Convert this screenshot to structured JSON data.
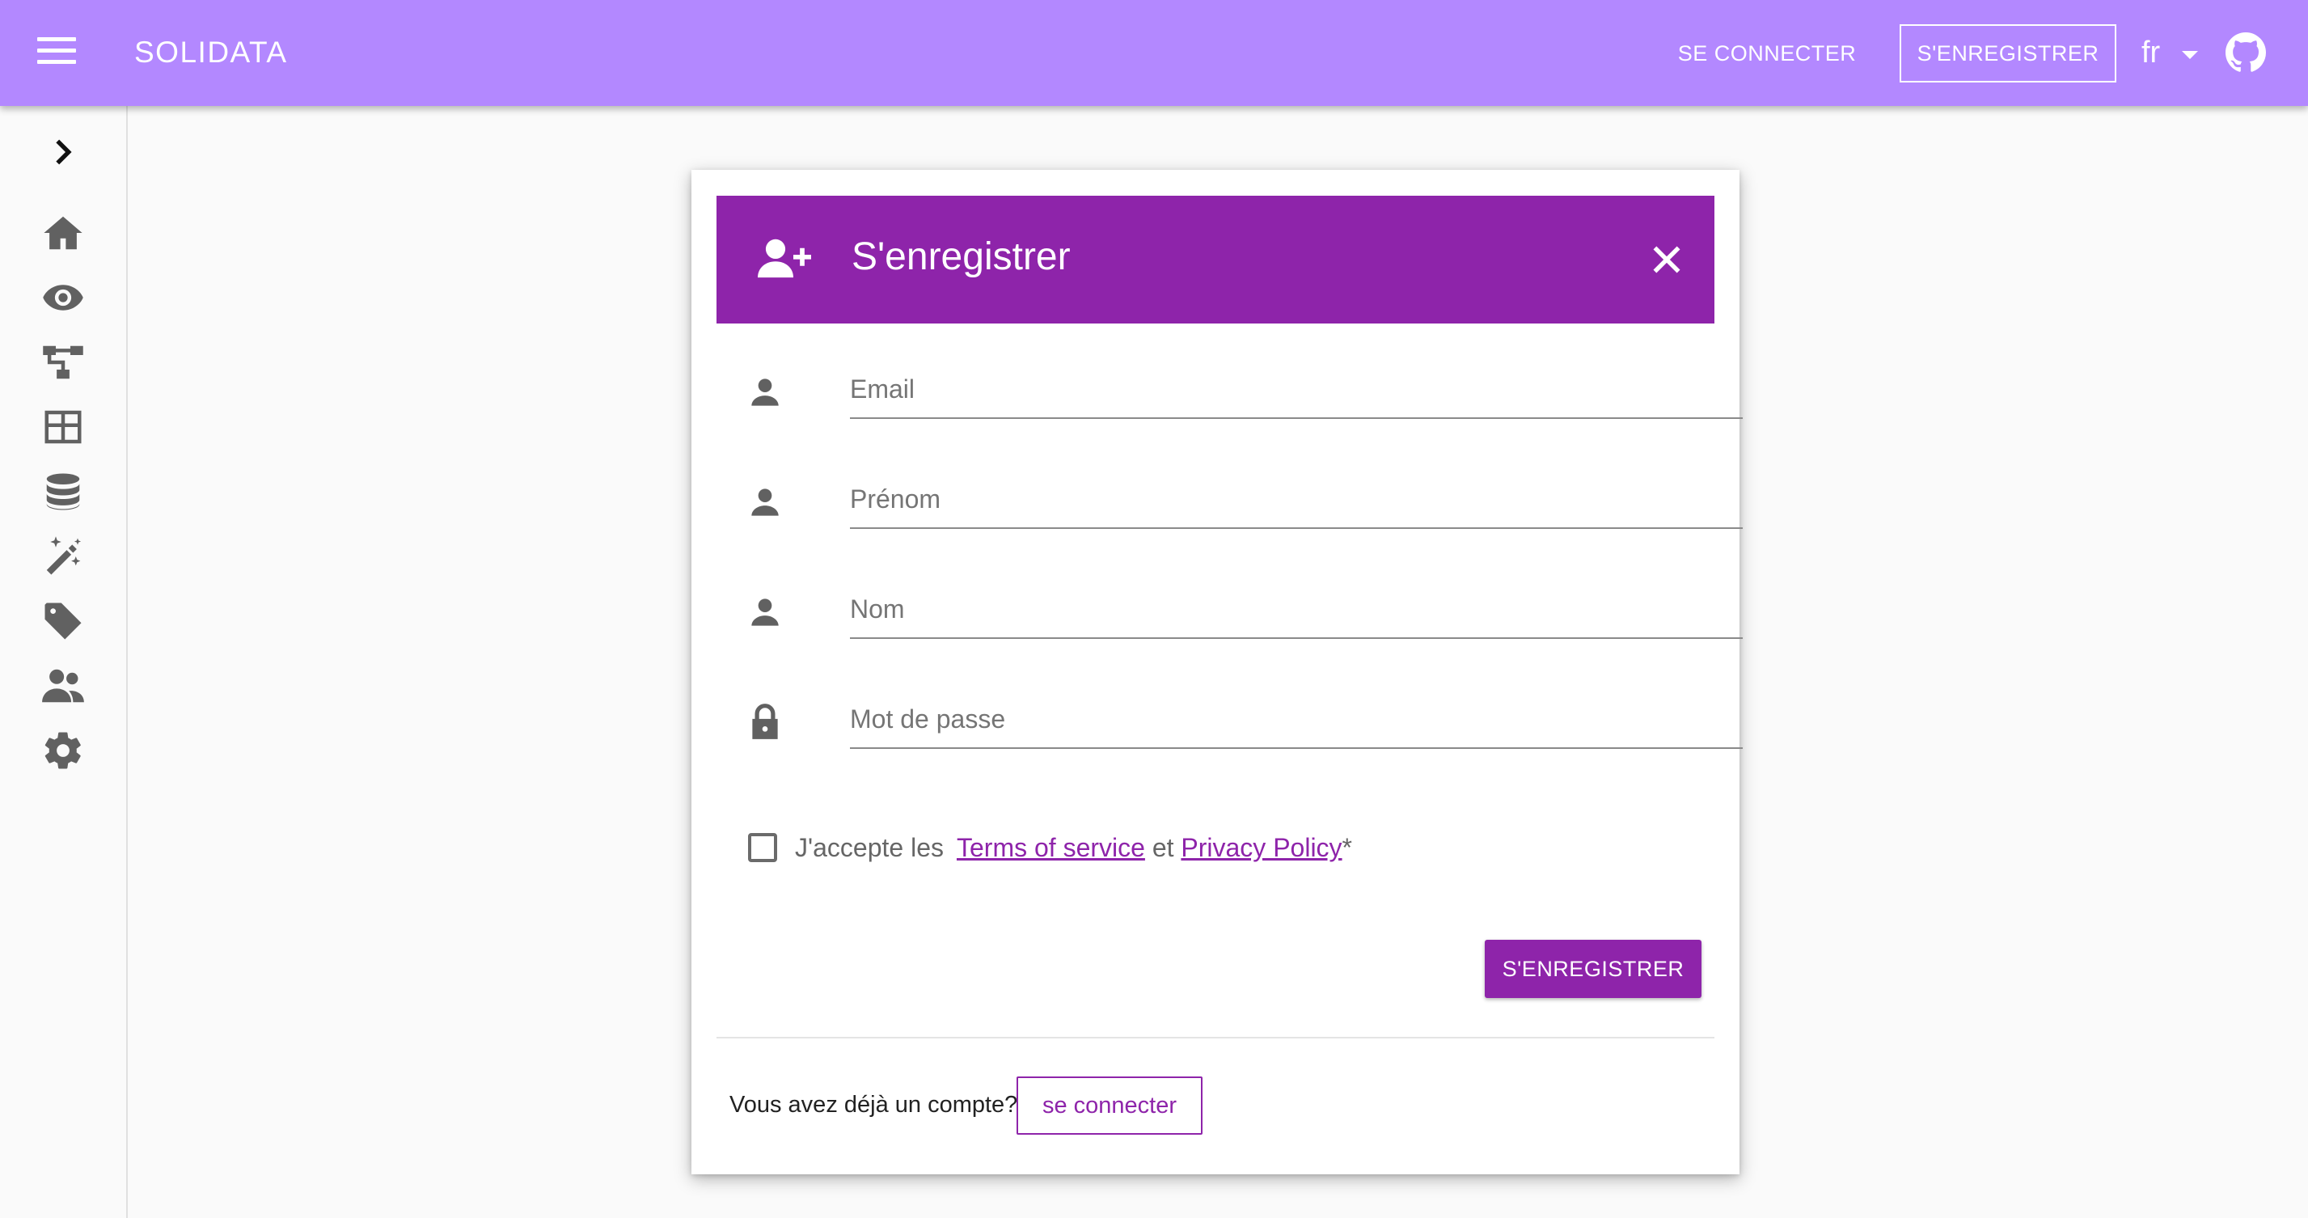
{
  "topbar": {
    "brand": "SOLIDATA",
    "login_label": "SE CONNECTER",
    "register_label": "S'ENREGISTRER",
    "language": "fr",
    "background": "#b388ff"
  },
  "sidebar": {
    "items": [
      {
        "icon": "chevron-right-icon"
      },
      {
        "icon": "home-icon"
      },
      {
        "icon": "eye-icon"
      },
      {
        "icon": "sitemap-icon"
      },
      {
        "icon": "table-icon"
      },
      {
        "icon": "database-icon"
      },
      {
        "icon": "magic-wand-icon"
      },
      {
        "icon": "tag-icon"
      },
      {
        "icon": "users-icon"
      },
      {
        "icon": "gear-icon"
      }
    ]
  },
  "modal": {
    "title": "S'enregistrer",
    "accent": "#8e24aa",
    "fields": {
      "email": {
        "placeholder": "Email",
        "value": ""
      },
      "firstname": {
        "placeholder": "Prénom",
        "value": ""
      },
      "lastname": {
        "placeholder": "Nom",
        "value": ""
      },
      "password": {
        "placeholder": "Mot de passe",
        "value": ""
      }
    },
    "terms": {
      "checked": false,
      "prefix": "J'accepte les",
      "tos_link": "Terms of service",
      "conjunction": "et",
      "privacy_link": "Privacy Policy",
      "required_mark": "*"
    },
    "submit_label": "S'ENREGISTRER",
    "already_text": "Vous avez déjà un compte?",
    "login_label": "se connecter"
  }
}
